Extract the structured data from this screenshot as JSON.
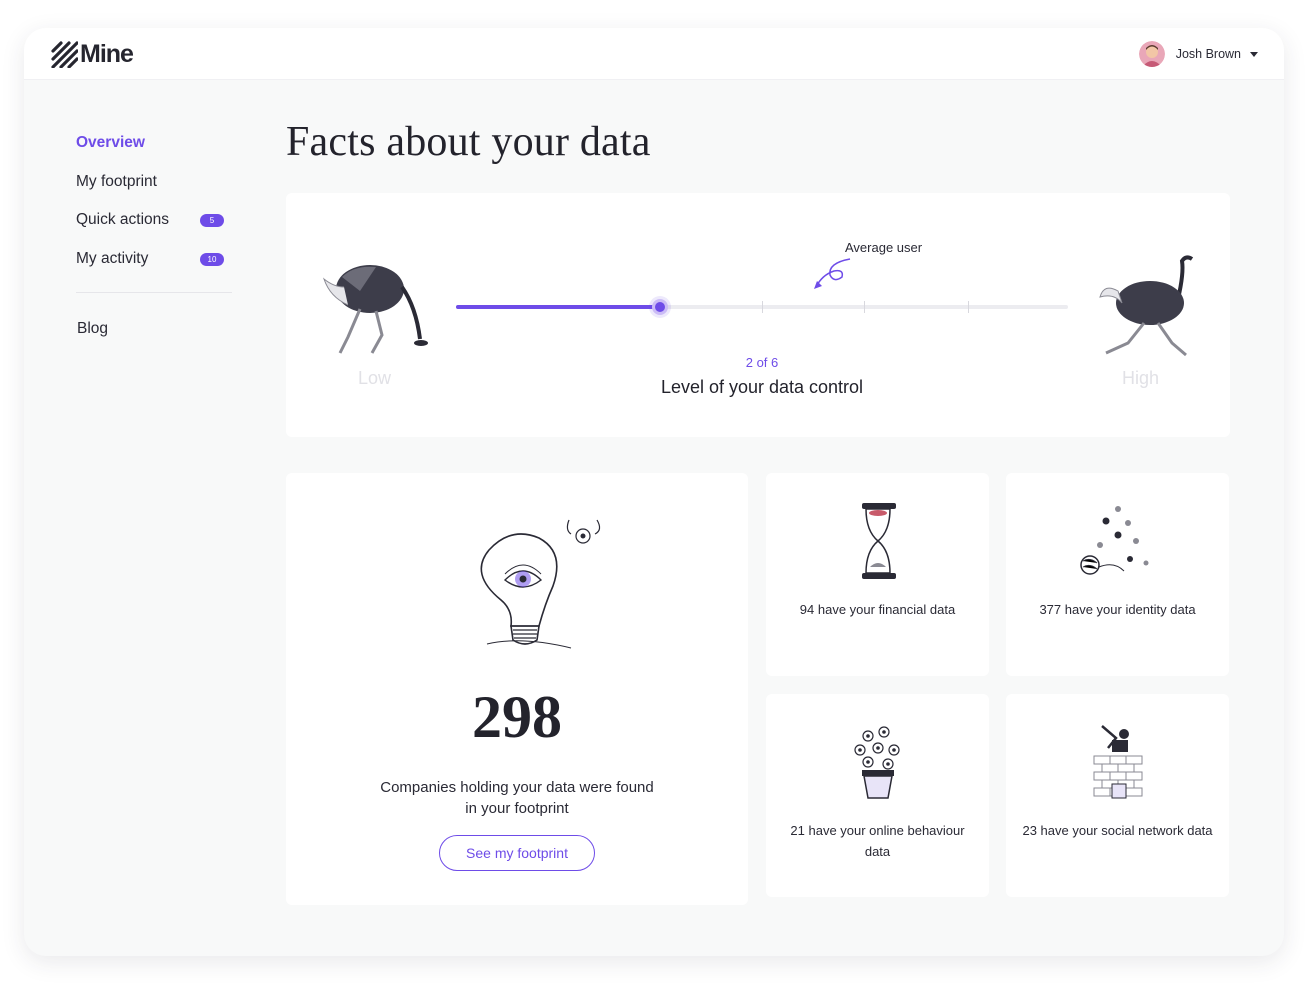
{
  "brand": {
    "name": "Mine",
    "accent": "#6e4ce8"
  },
  "user": {
    "name": "Josh Brown"
  },
  "sidebar": {
    "items": [
      {
        "label": "Overview",
        "active": true,
        "badge": ""
      },
      {
        "label": "My footprint",
        "active": false,
        "badge": ""
      },
      {
        "label": "Quick actions",
        "active": false,
        "badge": "5"
      },
      {
        "label": "My activity",
        "active": false,
        "badge": "10"
      }
    ],
    "blog": "Blog"
  },
  "page": {
    "title": "Facts about your data"
  },
  "control": {
    "average_label": "Average user",
    "step_text": "2 of 6",
    "level_label": "Level of your data control",
    "low_label": "Low",
    "high_label": "High",
    "current_level": 2,
    "max_level": 6
  },
  "companies": {
    "count": "298",
    "description": "Companies holding your data were found in your footprint",
    "button": "See my footprint"
  },
  "facts": [
    {
      "text": "94 have your financial data",
      "icon": "hourglass-icon"
    },
    {
      "text": "377 have your identity data",
      "icon": "scattered-eyes-icon"
    },
    {
      "text": "21 have your online behaviour data",
      "icon": "eye-plant-icon"
    },
    {
      "text": "23 have your social network data",
      "icon": "brick-wall-icon"
    }
  ]
}
